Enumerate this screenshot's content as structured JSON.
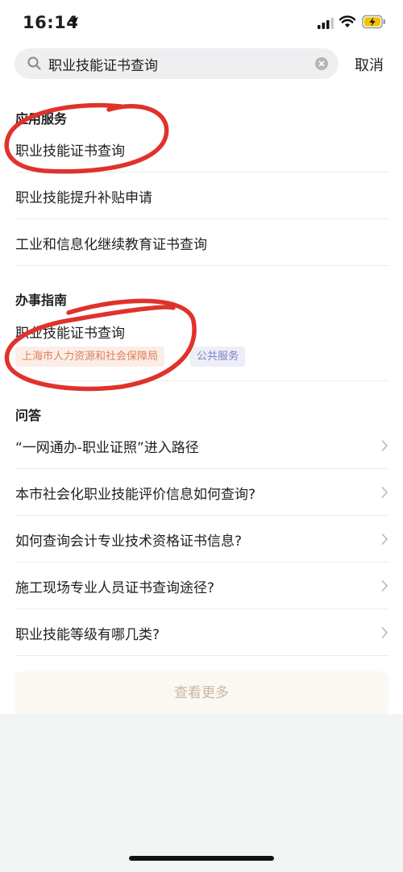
{
  "status_bar": {
    "time": "16:14",
    "icons": [
      "location-arrow-icon",
      "signal-icon",
      "wifi-icon",
      "battery-charging-icon"
    ]
  },
  "search": {
    "query": "职业技能证书查询",
    "cancel_label": "取消"
  },
  "sections": {
    "services": {
      "header": "应用服务",
      "items": [
        "职业技能证书查询",
        "职业技能提升补贴申请",
        "工业和信息化继续教育证书查询"
      ]
    },
    "guide": {
      "header": "办事指南",
      "item": {
        "title": "职业技能证书查询",
        "org_tag": "上海市人力资源和社会保障局",
        "type_tag": "公共服务"
      }
    },
    "qa": {
      "header": "问答",
      "items": [
        "“一网通办-职业证照”进入路径",
        "本市社会化职业技能评价信息如何查询?",
        "如何查询会计专业技术资格证书信息?",
        "施工现场专业人员证书查询途径?",
        "职业技能等级有哪几类?"
      ]
    }
  },
  "more_label": "查看更多",
  "colors": {
    "annotation_red": "#e0322c",
    "org_tag_text": "#e0805a",
    "type_tag_text": "#7d80c8",
    "more_text": "#c8b8a6"
  }
}
